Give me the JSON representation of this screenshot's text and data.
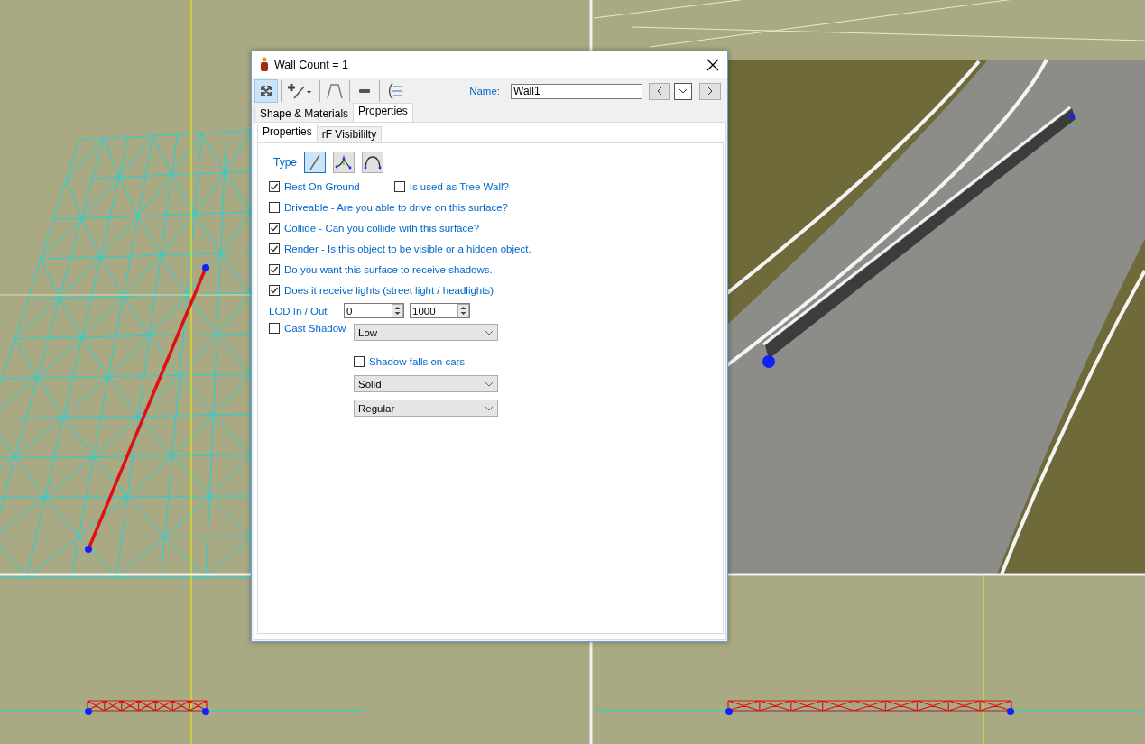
{
  "window": {
    "title": "Wall Count = 1"
  },
  "toolbar": {
    "tools": [
      {
        "kind": "move",
        "selected": true
      },
      {
        "kind": "add-line",
        "selected": false
      },
      {
        "kind": "profile",
        "selected": false
      },
      {
        "kind": "flat",
        "selected": false
      },
      {
        "kind": "curve",
        "selected": false
      }
    ],
    "name_label": "Name:",
    "name_value": "Wall1"
  },
  "tabs": [
    {
      "label": "Shape & Materials",
      "selected": false
    },
    {
      "label": "Properties",
      "selected": true
    }
  ],
  "subtabs": [
    {
      "label": "Properties",
      "selected": true
    },
    {
      "label": "rF Visibililty",
      "selected": false
    }
  ],
  "type": {
    "label": "Type",
    "options": [
      {
        "kind": "straight",
        "selected": true
      },
      {
        "kind": "spline",
        "selected": false
      },
      {
        "kind": "arc",
        "selected": false
      }
    ]
  },
  "option_rows": [
    [
      {
        "label": "Rest On Ground",
        "checked": true
      },
      {
        "label": "Is used as Tree Wall?",
        "checked": false
      }
    ],
    [
      {
        "label": "Driveable - Are you able to drive on this surface?",
        "checked": false
      }
    ],
    [
      {
        "label": "Collide - Can you collide with this surface?",
        "checked": true
      }
    ],
    [
      {
        "label": "Render - Is this object to be visible or a hidden object.",
        "checked": true
      }
    ],
    [
      {
        "label": "Do you want this surface to receive shadows.",
        "checked": true
      }
    ],
    [
      {
        "label": "Does it receive lights (street light / headlights)",
        "checked": true
      }
    ]
  ],
  "lod": {
    "label": "LOD In / Out",
    "in_value": "0",
    "out_value": "1000"
  },
  "shadow": {
    "cast": {
      "label": "Cast Shadow",
      "checked": false
    },
    "quality": "Low",
    "falls_on_cars": {
      "label": "Shadow falls on cars",
      "checked": false
    },
    "style": "Solid",
    "mode": "Regular"
  }
}
